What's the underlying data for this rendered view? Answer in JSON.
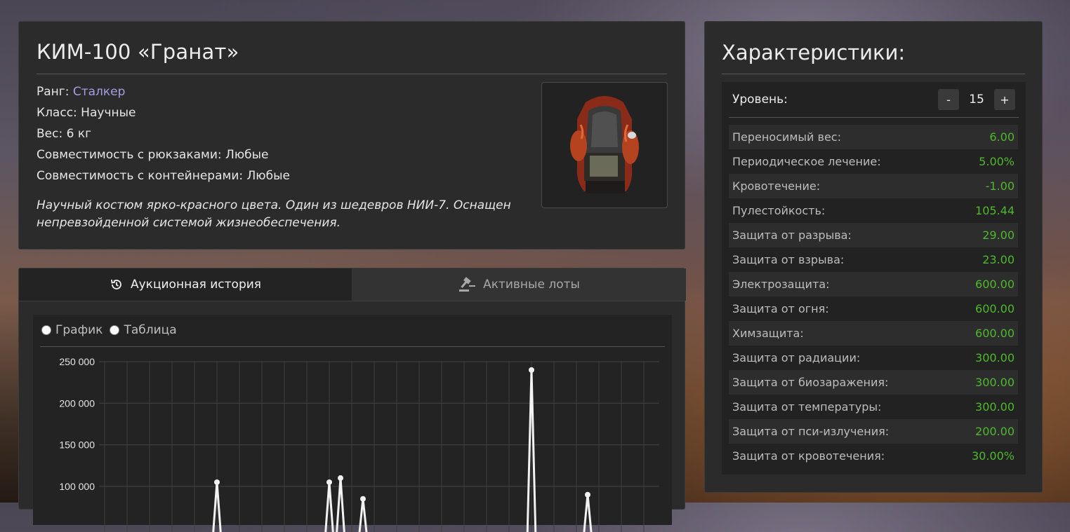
{
  "item": {
    "title": "КИМ-100 «Гранат»",
    "rank_label": "Ранг: ",
    "rank_value": "Сталкер",
    "class_text": "Класс: Научные",
    "weight_text": "Вес: 6 кг",
    "backpack_text": "Совместимость с рюкзаками: Любые",
    "container_text": "Совместимость с контейнерами: Любые",
    "description": "Научный костюм ярко-красного цвета. Один из шедевров НИИ-7. Оснащен непревзойденной системой жизнеобеспечения."
  },
  "tabs": {
    "history": "Аукционная история",
    "lots": "Активные лоты"
  },
  "view_options": {
    "graph": "График",
    "table": "Таблица"
  },
  "stats": {
    "title": "Характеристики:",
    "level_label": "Уровень:",
    "minus": "-",
    "plus": "+",
    "level_value": "15",
    "rows": [
      {
        "k": "Переносимый вес:",
        "v": "6.00"
      },
      {
        "k": "Периодическое лечение:",
        "v": "5.00%"
      },
      {
        "k": "Кровотечение:",
        "v": "-1.00"
      },
      {
        "k": "Пулестойкость:",
        "v": "105.44"
      },
      {
        "k": "Защита от разрыва:",
        "v": "29.00"
      },
      {
        "k": "Защита от взрыва:",
        "v": "23.00"
      },
      {
        "k": "Электрозащита:",
        "v": "600.00"
      },
      {
        "k": "Защита от огня:",
        "v": "600.00"
      },
      {
        "k": "Химзащита:",
        "v": "600.00"
      },
      {
        "k": "Защита от радиации:",
        "v": "300.00"
      },
      {
        "k": "Защита от биозаражения:",
        "v": "300.00"
      },
      {
        "k": "Защита от температуры:",
        "v": "300.00"
      },
      {
        "k": "Защита от пси-излучения:",
        "v": "200.00"
      },
      {
        "k": "Защита от кровотечения:",
        "v": "30.00%"
      }
    ],
    "value_color": "#4fb82d"
  },
  "chart_data": {
    "type": "line",
    "y_ticks": [
      "250 000",
      "200 000",
      "150 000",
      "100 000"
    ],
    "ylim": [
      80000,
      250000
    ],
    "grid": true,
    "series": [
      {
        "values": [
          {
            "x": 5,
            "y": 105000
          },
          {
            "x": 10,
            "y": 105000
          },
          {
            "x": 10.5,
            "y": 110000
          },
          {
            "x": 11.5,
            "y": 85000
          },
          {
            "x": 19,
            "y": 240000
          },
          {
            "x": 21.5,
            "y": 90000
          }
        ]
      }
    ]
  }
}
